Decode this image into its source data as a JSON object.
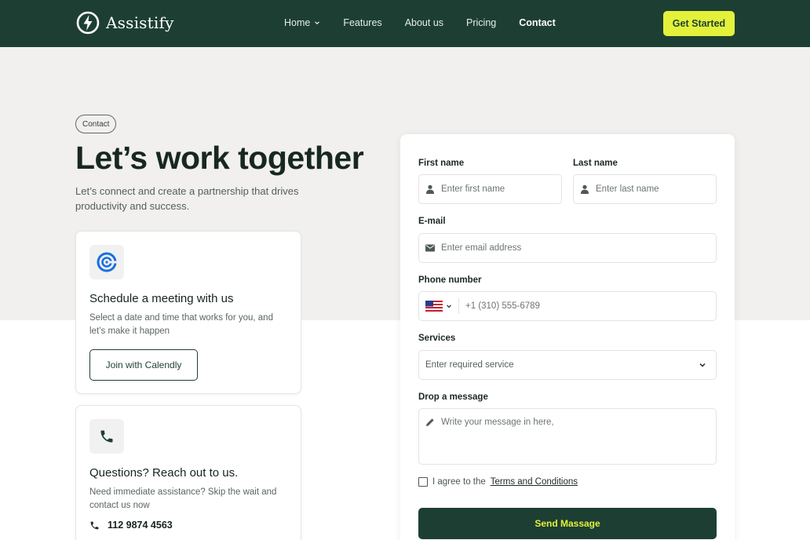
{
  "colors": {
    "nav_bg": "#1d3f33",
    "accent": "#e4f13a",
    "page_bg": "#f1f0ee"
  },
  "brand": {
    "name": "Assistify"
  },
  "nav": {
    "links": [
      "Home",
      "Features",
      "About us",
      "Pricing",
      "Contact"
    ],
    "active": "Contact",
    "cta_label": "Get Started"
  },
  "hero": {
    "pill": "Contact",
    "title": "Let’s work together",
    "subtitle": "Let’s connect and create a partnership that drives productivity and success."
  },
  "cards": {
    "meeting": {
      "icon": "calendly-icon",
      "title": "Schedule a meeting with us",
      "text": "Select a date and time that works for you, and let’s make it happen",
      "button": "Join with Calendly"
    },
    "questions": {
      "icon": "phone-icon",
      "title": "Questions? Reach out to us.",
      "text": "Need immediate assistance? Skip the wait and contact us now",
      "phone": "112 9874 4563"
    }
  },
  "form": {
    "first_name": {
      "label": "First name",
      "placeholder": "Enter first name"
    },
    "last_name": {
      "label": "Last name",
      "placeholder": "Enter last name"
    },
    "email": {
      "label": "E-mail",
      "placeholder": "Enter email address"
    },
    "phone": {
      "label": "Phone number",
      "placeholder": "+1 (310) 555-6789",
      "country": "US"
    },
    "services": {
      "label": "Services",
      "placeholder": "Enter required service"
    },
    "message": {
      "label": "Drop a message",
      "placeholder": "Write your message in here,"
    },
    "agree_text": "I agree to the",
    "terms_link": "Terms and Conditions",
    "submit": "Send Massage"
  }
}
